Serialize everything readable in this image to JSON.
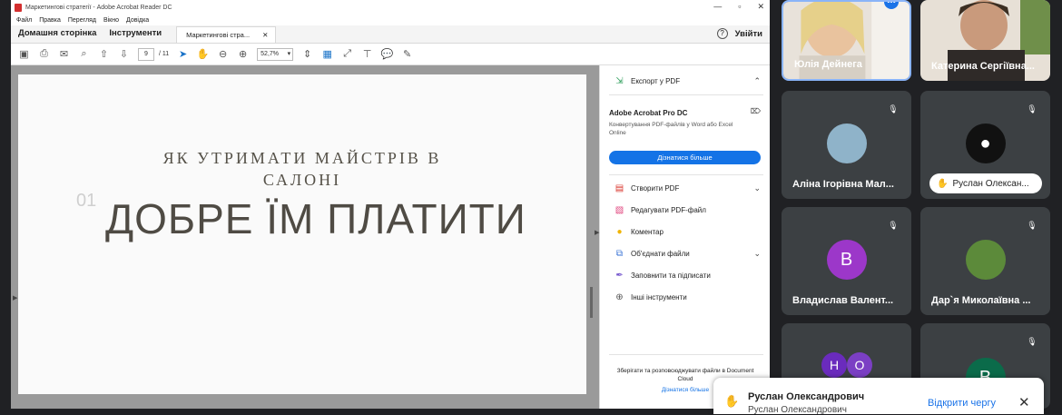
{
  "acrobat": {
    "window_title": "Маркетингові стратегії - Adobe Acrobat Reader DC",
    "window_controls": [
      "—",
      "▫",
      "✕"
    ],
    "menu": [
      "Файл",
      "Правка",
      "Перегляд",
      "Вікно",
      "Довідка"
    ],
    "tabs": {
      "home": "Домашня сторінка",
      "tools": "Інструменти",
      "doc": "Маркетингові стра...",
      "doc_close": "✕"
    },
    "signin": "Увійти",
    "page_current": "9",
    "page_total": "/ 11",
    "zoom": "52,7%"
  },
  "slide": {
    "subtitle_line1": "ЯК УТРИМАТИ МАЙСТРІВ В",
    "subtitle_line2": "САЛОНІ",
    "number": "01",
    "headline": "ДОБРЕ ЇМ ПЛАТИТИ"
  },
  "right_pane": {
    "export": "Експорт у PDF",
    "promo_title": "Adobe Acrobat Pro DC",
    "promo_text": "Конвертування PDF-файлів у Word або Excel Online",
    "promo_button": "Дізнатися більше",
    "create": "Створити PDF",
    "edit": "Редагувати PDF-файл",
    "comment": "Коментар",
    "combine": "Об'єднати файли",
    "fill_sign": "Заповнити та підписати",
    "more_tools": "Інші інструменти",
    "cloud_text": "Зберігати та розповсюджувати файли в Document Cloud",
    "cloud_link": "Дізнатися більше"
  },
  "meet": {
    "participants": [
      {
        "name": "Юлія Дейнега"
      },
      {
        "name": "Катерина Сергіївна..."
      },
      {
        "name": "Аліна Ігорівна Мал..."
      },
      {
        "name": "Руслан Олексан..."
      },
      {
        "name": "Владислав Валент...",
        "initial": "В",
        "color": "#9c37c9"
      },
      {
        "name": "Дар`я Миколаївна ..."
      },
      {
        "initials": [
          "Н",
          "О"
        ],
        "colors": [
          "#6a2bbd",
          "#7b3fc4"
        ]
      },
      {
        "initial": "В",
        "color": "#0b6b4a"
      }
    ],
    "toast": {
      "name": "Руслан Олександрович",
      "subtitle": "Руслан Олександрович",
      "open_queue": "Відкрити чергу",
      "close": "✕"
    }
  }
}
